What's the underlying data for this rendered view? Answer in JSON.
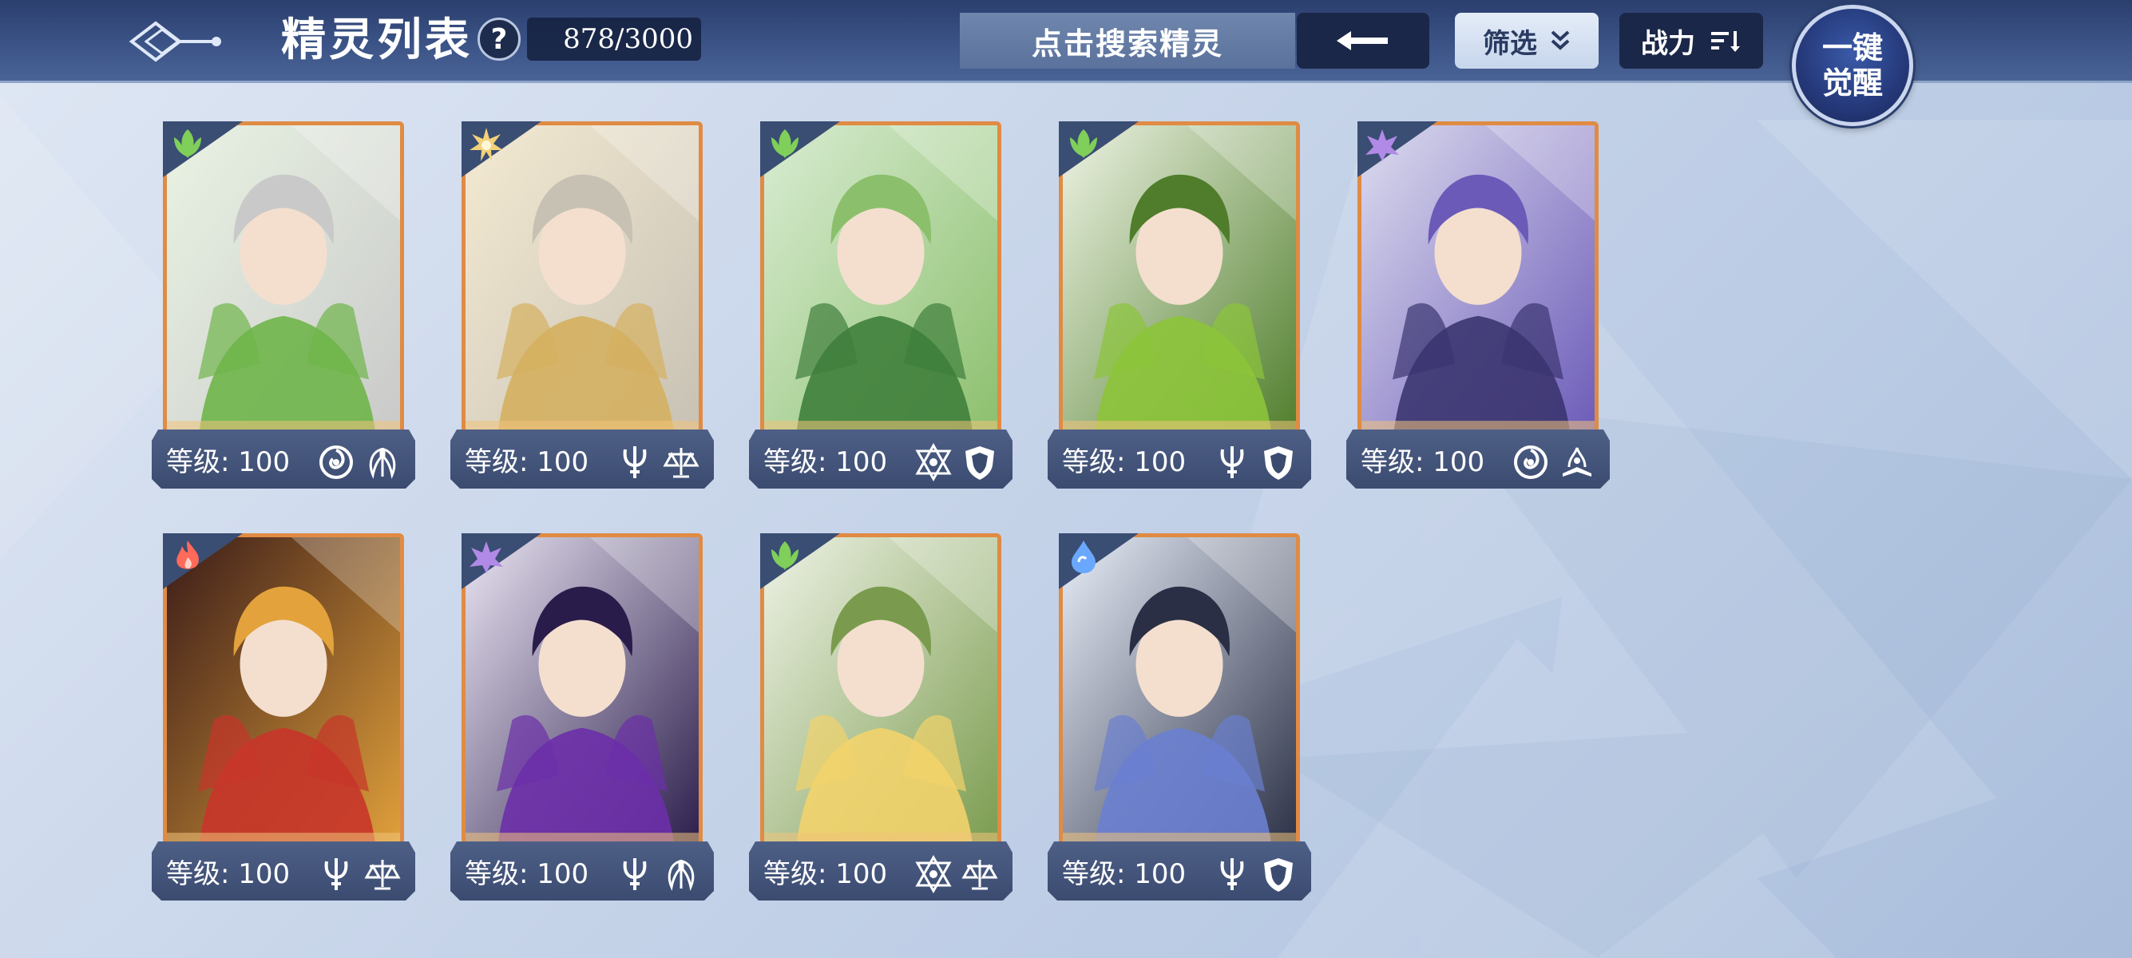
{
  "header": {
    "title": "精灵列表",
    "help": "?",
    "count": "878/3000",
    "search_placeholder": "点击搜索精灵",
    "filter_label": "筛选",
    "sort_label": "战力",
    "awaken_line1": "一键",
    "awaken_line2": "觉醒"
  },
  "colors": {
    "card_border": "#e08b44",
    "grass": "#7fcf5a",
    "light": "#f2d27a",
    "dark": "#b08ae6",
    "fire": "#ff6a5a",
    "water": "#6aa8ff"
  },
  "cards": [
    {
      "level": "等级: 100",
      "element": "grass-icon",
      "tags": [
        "swirl-icon",
        "wings-icon"
      ],
      "palette": [
        "#e9f3e3",
        "#6fb54a",
        "#c9c9c9"
      ]
    },
    {
      "level": "等级: 100",
      "element": "light-icon",
      "tags": [
        "trident-icon",
        "scales-icon"
      ],
      "palette": [
        "#f4ead2",
        "#d4b060",
        "#c7c1b4"
      ]
    },
    {
      "level": "等级: 100",
      "element": "grass-icon",
      "tags": [
        "star-icon",
        "shield-icon"
      ],
      "palette": [
        "#d9ecd3",
        "#3f7f3c",
        "#8bbf6c"
      ]
    },
    {
      "level": "等级: 100",
      "element": "grass-icon",
      "tags": [
        "trident-icon",
        "shield-icon"
      ],
      "palette": [
        "#eef3e4",
        "#8cc43a",
        "#4f7d2b"
      ]
    },
    {
      "level": "等级: 100",
      "element": "dark-icon",
      "tags": [
        "swirl-icon",
        "book-icon"
      ],
      "palette": [
        "#dcdcee",
        "#3b3570",
        "#6b5ab8"
      ]
    },
    {
      "level": "等级: 100",
      "element": "fire-icon",
      "tags": [
        "trident-icon",
        "scales-icon"
      ],
      "palette": [
        "#3a1b18",
        "#c8352a",
        "#e3a23b"
      ]
    },
    {
      "level": "等级: 100",
      "element": "dark-icon",
      "tags": [
        "trident-icon",
        "wings-icon"
      ],
      "palette": [
        "#e9e4f2",
        "#6b2fa8",
        "#2a1c4a"
      ]
    },
    {
      "level": "等级: 100",
      "element": "grass-icon",
      "tags": [
        "star-icon",
        "scales-icon"
      ],
      "palette": [
        "#eef2e6",
        "#f2d36b",
        "#7a9b4d"
      ]
    },
    {
      "level": "等级: 100",
      "element": "water-icon",
      "tags": [
        "trident-icon",
        "shield-icon"
      ],
      "palette": [
        "#e7eef8",
        "#6a7fd0",
        "#2a2f45"
      ]
    }
  ]
}
